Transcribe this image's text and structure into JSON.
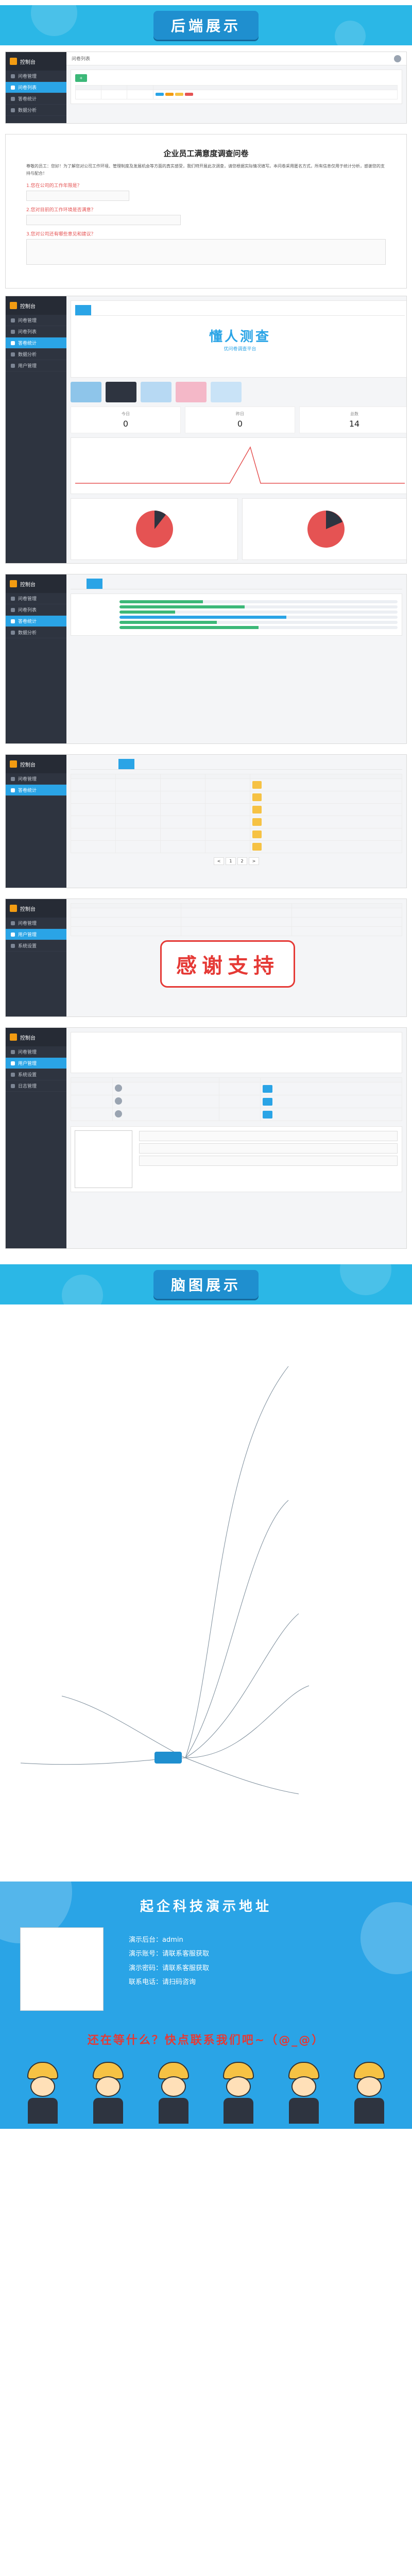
{
  "sections": {
    "backend_banner": "后端展示",
    "mindmap_banner": "脑图展示",
    "footer_title": "起企科技演示地址",
    "thanks_stamp": "感谢支持",
    "footer_cta": "还在等什么？快点联系我们吧~（@_@）"
  },
  "survey": {
    "title": "企业员工满意度调查问卷",
    "intro": "尊敬的员工：您好！为了解您对公司工作环境、管理制度及发展机会等方面的真实感受，我们特开展此次调查，请您根据实际情况填写。本问卷采用匿名方式，所有信息仅用于统计分析，感谢您的支持与配合！",
    "q1": "1.您在公司的工作年限是？",
    "q2": "2.您对目前的工作环境是否满意？",
    "q3": "3.您对公司还有哪些意见和建议？"
  },
  "stats": [
    {
      "label": "今日",
      "value": "0"
    },
    {
      "label": "昨日",
      "value": "0"
    },
    {
      "label": "总数",
      "value": "14"
    }
  ],
  "stamp_preview": {
    "line1": "懂人测查",
    "line2": "优问卷调查平台"
  },
  "footer_lines": [
    "演示后台：admin",
    "演示账号：请联系客服获取",
    "演示密码：请联系客服获取",
    "联系电话：请扫码咨询"
  ],
  "sidebar": [
    "控制台",
    "问卷管理",
    "问卷列表",
    "答卷统计",
    "数据分析",
    "用户管理",
    "系统设置",
    "日志管理"
  ]
}
